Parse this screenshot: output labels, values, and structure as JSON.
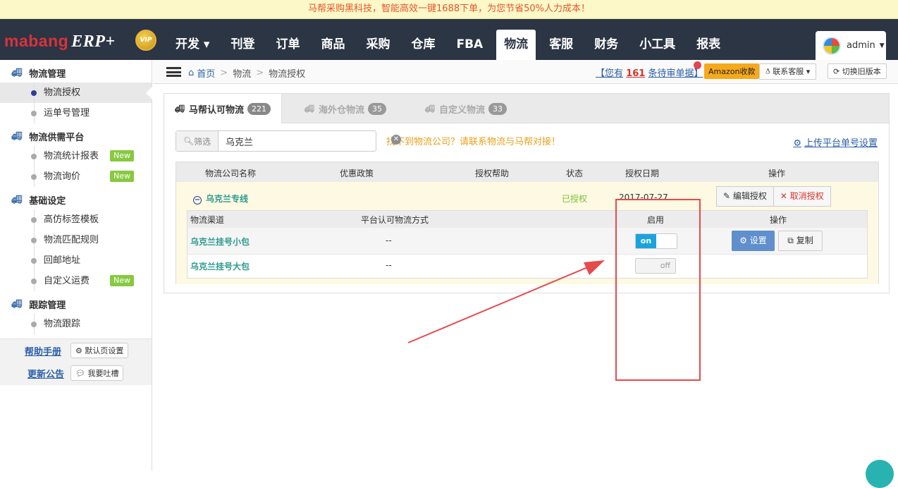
{
  "banner": {
    "text": "马帮采购黑科技，智能高效一键1688下单，为您节省50%人力成本！"
  },
  "header": {
    "logo": "mabang",
    "logo_erp": "ERP+",
    "vip": "VIP",
    "nav": [
      "开发 ▾",
      "刊登",
      "订单",
      "商品",
      "采购",
      "仓库",
      "FBA",
      "物流",
      "客服",
      "财务",
      "小工具",
      "报表"
    ],
    "active_nav": "物流",
    "user": "admin"
  },
  "sidebar": {
    "groups": [
      {
        "title": "物流管理",
        "items": [
          {
            "label": "物流授权",
            "active": true
          },
          {
            "label": "运单号管理"
          }
        ]
      },
      {
        "title": "物流供需平台",
        "items": [
          {
            "label": "物流统计报表",
            "badge": "New"
          },
          {
            "label": "物流询价",
            "badge": "New"
          }
        ]
      },
      {
        "title": "基础设定",
        "items": [
          {
            "label": "高仿标签模板"
          },
          {
            "label": "物流匹配规则"
          },
          {
            "label": "回邮地址"
          },
          {
            "label": "自定义运费",
            "badge": "New"
          }
        ]
      },
      {
        "title": "跟踪管理",
        "items": [
          {
            "label": "物流跟踪"
          }
        ]
      }
    ],
    "footer": {
      "help": "帮助手册",
      "default_page": "默认页设置",
      "announce": "更新公告",
      "feedback": "我要吐槽"
    }
  },
  "breadcrumb": {
    "home": "首页",
    "level1": "物流",
    "level2": "物流授权"
  },
  "toolbar": {
    "pending_prefix": "【您有",
    "pending_count": "161",
    "pending_suffix": "条待审单据】",
    "amazon": "Amazon收款",
    "kefu": "联系客服",
    "old_version": "切换旧版本"
  },
  "tabs": [
    {
      "label": "马帮认可物流",
      "count": "221"
    },
    {
      "label": "海外仓物流",
      "count": "35"
    },
    {
      "label": "自定义物流",
      "count": "33"
    }
  ],
  "filter": {
    "label": "筛选",
    "value": "乌克兰"
  },
  "hint": "找不到物流公司？请联系物流与马帮对接！",
  "upload_link": "上传平台单号设置",
  "table": {
    "headers": [
      "物流公司名称",
      "优惠政策",
      "授权帮助",
      "状态",
      "授权日期",
      "操作"
    ],
    "company": {
      "name": "乌克兰专线",
      "status": "已授权",
      "date": "2017-07-27",
      "edit": "编辑授权",
      "cancel": "取消授权"
    },
    "sub_headers": [
      "物流渠道",
      "平台认可物流方式",
      "启用",
      "操作"
    ],
    "channels": [
      {
        "name": "乌克兰挂号小包",
        "method": "--",
        "toggle": "on",
        "set": "设置",
        "copy": "复制"
      },
      {
        "name": "乌克兰挂号大包",
        "method": "--",
        "toggle": "off"
      }
    ]
  }
}
